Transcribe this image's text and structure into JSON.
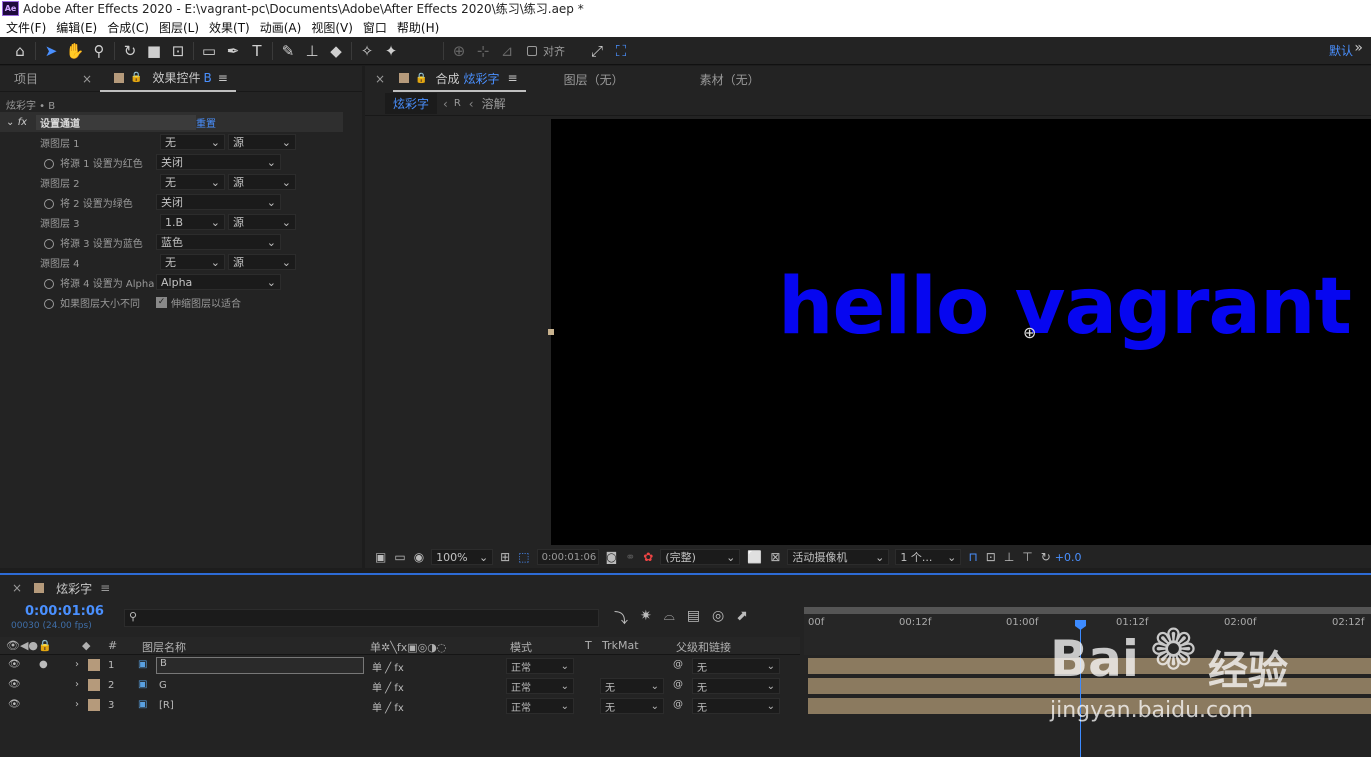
{
  "window": {
    "title": "Adobe After Effects 2020 - E:\\vagrant-pc\\Documents\\Adobe\\After Effects 2020\\练习\\练习.aep *",
    "logo": "Ae"
  },
  "menu": [
    "文件(F)",
    "编辑(E)",
    "合成(C)",
    "图层(L)",
    "效果(T)",
    "动画(A)",
    "视图(V)",
    "窗口",
    "帮助(H)"
  ],
  "toolbar": {
    "snap_label": "对齐",
    "workspace": "默认"
  },
  "left_panel": {
    "tab_project": "项目",
    "tab_effect_controls": "效果控件",
    "tab_effect_target": "B",
    "context": "炫彩字 • B",
    "effect_name": "设置通道",
    "reset_label": "重置",
    "rows": [
      {
        "label": "源图层 1",
        "val1": "无",
        "val2": "源"
      },
      {
        "label": "将源 1 设置为红色",
        "val1": "关闭"
      },
      {
        "label": "源图层 2",
        "val1": "无",
        "val2": "源"
      },
      {
        "label": "将 2 设置为绿色",
        "val1": "关闭"
      },
      {
        "label": "源图层 3",
        "val1": "1.B",
        "val2": "源"
      },
      {
        "label": "将源 3 设置为蓝色",
        "val1": "蓝色"
      },
      {
        "label": "源图层 4",
        "val1": "无",
        "val2": "源"
      },
      {
        "label": "将源 4 设置为 Alpha",
        "val1": "Alpha"
      }
    ],
    "fit_label": "如果图层大小不同",
    "fit_checkbox": "伸缩图层以适合"
  },
  "comp_panel": {
    "tab_comp": "合成",
    "tab_comp_name": "炫彩字",
    "tab_layer": "图层（无）",
    "tab_footage": "素材（无）",
    "breadcrumbs": [
      "炫彩字",
      "R",
      "溶解"
    ],
    "text": "hello vagrant",
    "zoom": "100%",
    "timecode": "0:00:01:06",
    "resolution": "(完整)",
    "camera": "活动摄像机",
    "views": "1 个...",
    "exposure": "+0.0"
  },
  "timeline": {
    "tab": "炫彩字",
    "timecode": "0:00:01:06",
    "fps": "00030 (24.00 fps)",
    "columns": {
      "num": "#",
      "name": "图层名称",
      "mode": "模式",
      "t": "T",
      "trkmat": "TrkMat",
      "parent": "父级和链接"
    },
    "layers": [
      {
        "num": "1",
        "name": "B",
        "mode": "正常",
        "trkmat": "",
        "parent": "无"
      },
      {
        "num": "2",
        "name": "G",
        "mode": "正常",
        "trkmat": "无",
        "parent": "无"
      },
      {
        "num": "3",
        "name": "[R]",
        "mode": "正常",
        "trkmat": "无",
        "parent": "无"
      }
    ],
    "ruler": [
      "00f",
      "00:12f",
      "01:00f",
      "01:12f",
      "02:00f",
      "02:12f"
    ]
  },
  "watermark": {
    "brand": "Bai",
    "brand2": "经验",
    "url": "jingyan.baidu.com"
  }
}
